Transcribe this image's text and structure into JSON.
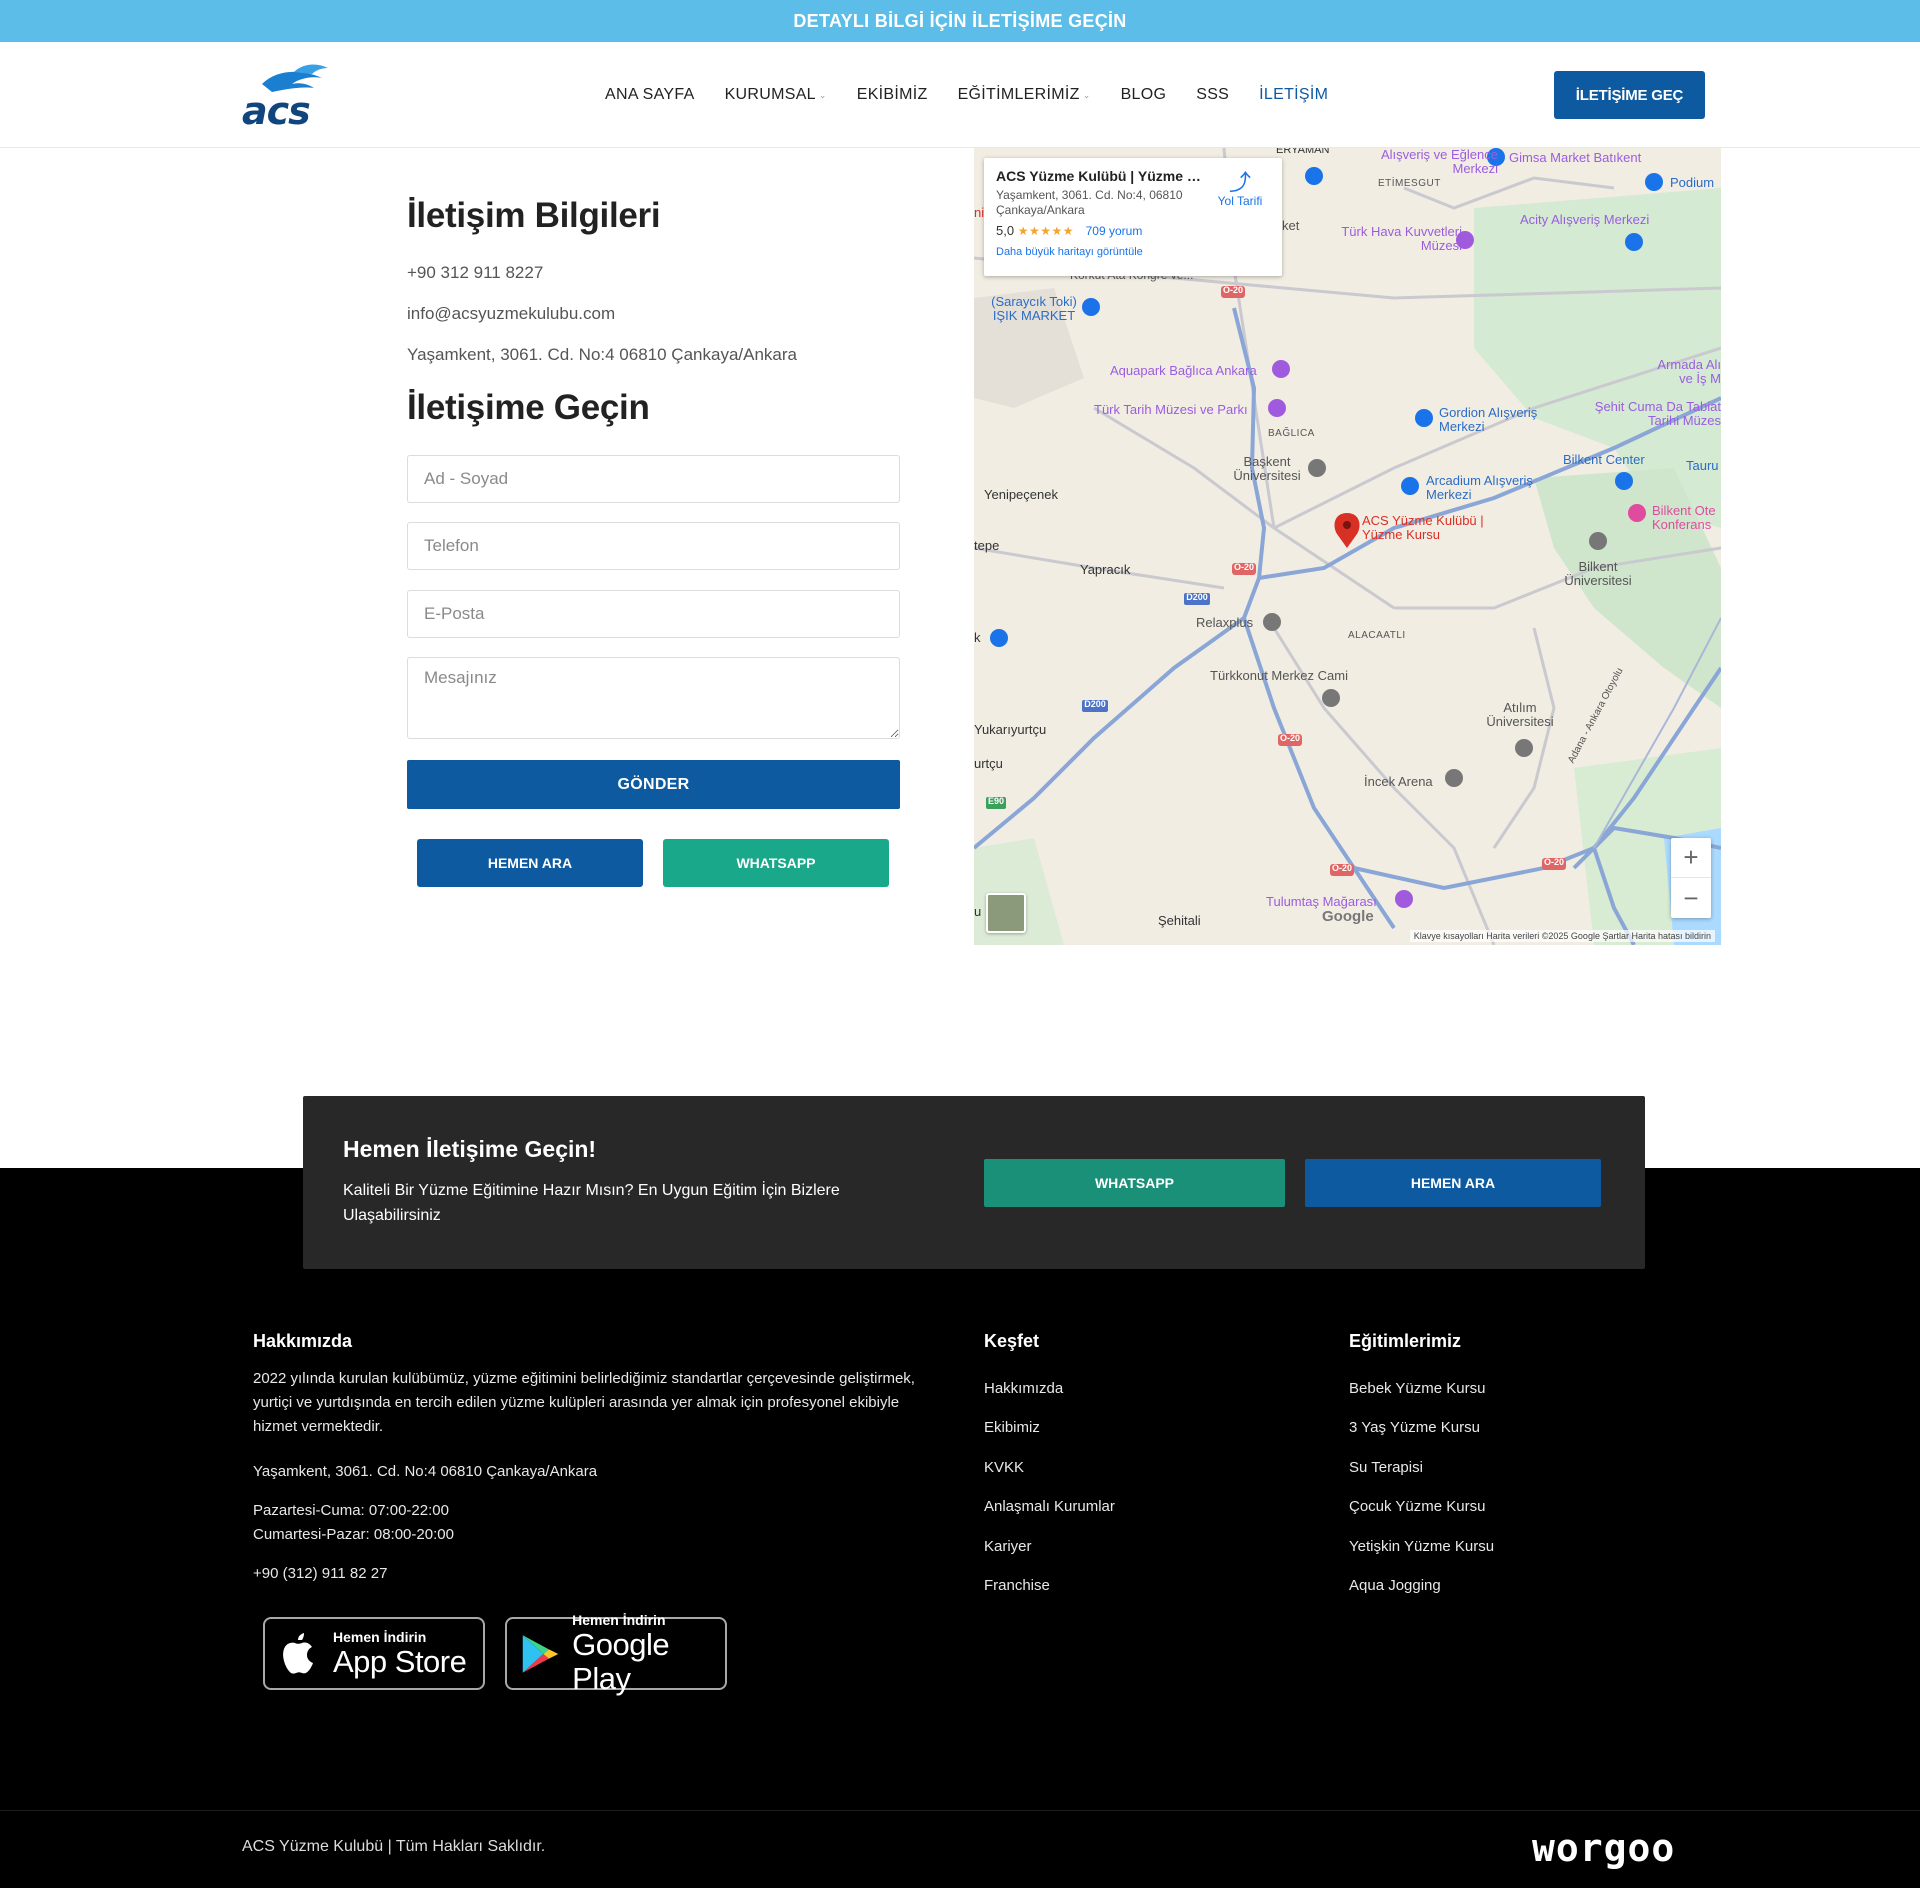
{
  "topbar": {
    "text": "DETAYLI BİLGİ İÇİN İLETİŞİME GEÇİN"
  },
  "header": {
    "logo_text": "acs",
    "nav": [
      {
        "label": "ANA SAYFA",
        "dropdown": false,
        "active": false
      },
      {
        "label": "KURUMSAL",
        "dropdown": true,
        "active": false
      },
      {
        "label": "EKİBİMİZ",
        "dropdown": false,
        "active": false
      },
      {
        "label": "EĞİTİMLERİMİZ",
        "dropdown": true,
        "active": false
      },
      {
        "label": "BLOG",
        "dropdown": false,
        "active": false
      },
      {
        "label": "SSS",
        "dropdown": false,
        "active": false
      },
      {
        "label": "İLETİŞİM",
        "dropdown": false,
        "active": true
      }
    ],
    "cta_label": "İLETİŞİME GEÇ"
  },
  "contact": {
    "info_title": "İletişim Bilgileri",
    "phone": "+90 312 911 8227",
    "email": "info@acsyuzmekulubu.com",
    "address": "Yaşamkent, 3061. Cd. No:4 06810 Çankaya/Ankara",
    "form_title": "İletişime Geçin",
    "fields": {
      "name_placeholder": "Ad - Soyad",
      "phone_placeholder": "Telefon",
      "email_placeholder": "E-Posta",
      "message_placeholder": "Mesajınız"
    },
    "submit_label": "GÖNDER",
    "call_label": "HEMEN ARA",
    "whatsapp_label": "WHATSAPP"
  },
  "map": {
    "card_title": "ACS Yüzme Kulübü | Yüzme K...",
    "card_address": "Yaşamkent, 3061. Cd. No:4, 06810 Çankaya/Ankara",
    "rating": "5,0",
    "stars": "★★★★★",
    "reviews": "709 yorum",
    "bigger_map": "Daha büyük haritayı görüntüle",
    "directions": "Yol Tarifi",
    "zoom_in": "+",
    "zoom_out": "−",
    "google": "Google",
    "attribution": "Klavye kısayolları   Harita verileri ©2025 Google   Şartlar   Harita hatası bildirin",
    "labels": {
      "eryaman": "ERYAMAN",
      "alisveris_eglence": "Alışveriş ve Eğlence Merkezi",
      "gimsa": "Gimsa Market Batıkent",
      "podium": "Podium",
      "etimesgut": "ETİMESGUT",
      "acity": "Acity Alışveriş Merkezi",
      "turk_hava": "Türk Hava Kuvvetleri Müzesi",
      "market": "ket",
      "kongre": "Korkut Ata Kongre ve...",
      "saracik": "(Saraycık Toki) IŞIK MARKET",
      "aquapark": "Aquapark Bağlıca Ankara",
      "armada": "Armada Alı ve İş M",
      "turk_tarih": "Türk Tarih Müzesi ve Parkı",
      "gordion": "Gordion Alışveriş Merkezi",
      "sehit_cuma": "Şehit Cuma Da Tabiat Tarihi Müzes",
      "baglica": "BAĞLICA",
      "baskent": "Başkent Üniversitesi",
      "bilkent_center": "Bilkent Center",
      "tauru": "Tauru",
      "yenipecenek": "Yenipeçenek",
      "arcadium": "Arcadium Alışveriş Merkezi",
      "bilkent_otel": "Bilkent Ote Konferans",
      "acs_pin": "ACS Yüzme Kulübü | Yüzme Kursu",
      "tepe": "tepe",
      "yapracik": "Yapracık",
      "bilkent_uni": "Bilkent Üniversitesi",
      "relaxplus": "Relaxplus",
      "alacaatli": "ALACAATLI",
      "k_label": "k",
      "turkkonut": "Türkkonut Merkez Cami",
      "atilim": "Atılım Üniversitesi",
      "yukariyurtcu": "Yukarıyurtçu",
      "urtcu": "urtçu",
      "incek": "İncek Arena",
      "tulumtas": "Tulumtaş Mağarası",
      "sehitali": "Şehitali",
      "road_o20": "O-20",
      "road_d200": "D200",
      "road_e90": "E90",
      "adana_ankara": "Adana - Ankara Otoyolu",
      "u_label": "u",
      "ni": "ni"
    }
  },
  "cta_strip": {
    "title": "Hemen İletişime Geçin!",
    "subtitle": "Kaliteli Bir Yüzme Eğitimine Hazır Mısın? En Uygun Eğitim İçin Bizlere Ulaşabilirsiniz",
    "whatsapp_label": "WHATSAPP",
    "call_label": "HEMEN ARA"
  },
  "footer": {
    "about_title": "Hakkımızda",
    "about_text": "2022 yılında kurulan kulübümüz, yüzme eğitimini belirlediğimiz standartlar çerçevesinde geliştirmek, yurtiçi ve yurtdışında en tercih edilen yüzme kulüpleri arasında yer almak için profesyonel ekibiyle hizmet vermektedir.",
    "address": "Yaşamkent, 3061. Cd. No:4 06810 Çankaya/Ankara",
    "hours_weekday": "Pazartesi-Cuma: 07:00-22:00",
    "hours_weekend": "Cumartesi-Pazar: 08:00-20:00",
    "phone": "+90 (312) 911 82 27",
    "explore_title": "Keşfet",
    "explore_links": [
      "Hakkımızda",
      "Ekibimiz",
      "KVKK",
      "Anlaşmalı Kurumlar",
      "Kariyer",
      "Franchise"
    ],
    "trainings_title": "Eğitimlerimiz",
    "training_links": [
      "Bebek Yüzme Kursu",
      "3 Yaş Yüzme Kursu",
      "Su Terapisi",
      "Çocuk Yüzme Kursu",
      "Yetişkin Yüzme Kursu",
      "Aqua Jogging"
    ],
    "appstore_small": "Hemen İndirin",
    "appstore_large": "App Store",
    "googleplay_small": "Hemen İndirin",
    "googleplay_large": "Google Play",
    "copyright": "ACS Yüzme Kulubü | Tüm Hakları Saklıdır.",
    "brand": "worgoo"
  },
  "colors": {
    "topbar": "#5bbde8",
    "primary": "#0e5aa0",
    "whatsapp": "#1aa88a",
    "cta_strip": "#282828",
    "footer": "#000000"
  }
}
